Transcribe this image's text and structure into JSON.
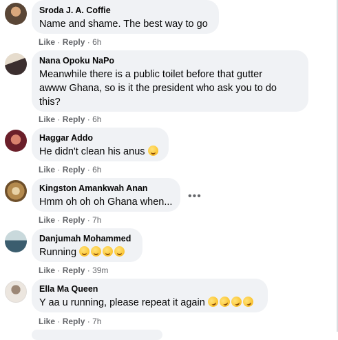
{
  "comments": [
    {
      "author": "Sroda J. A. Coffie",
      "text": "Name and shame. The best way to go",
      "like": "Like",
      "reply": "Reply",
      "time": "6h",
      "avatar_colors": [
        "#6d5b4a",
        "#c8a27a"
      ]
    },
    {
      "author": "Nana Opoku NaPo",
      "text_line1": "Meanwhile there is a public toilet before that gutter",
      "text_line2": "awww Ghana, so is it the president who ask you to do",
      "text_line3": "this?",
      "like": "Like",
      "reply": "Reply",
      "time": "6h",
      "avatar_colors": [
        "#3a3030",
        "#d9c9b8"
      ]
    },
    {
      "author": "Haggar Addo",
      "text": "He didn't clean his anus",
      "emoji": "grinning-face",
      "like": "Like",
      "reply": "Reply",
      "time": "6h",
      "avatar_colors": [
        "#6b1f2a",
        "#d07a6a"
      ]
    },
    {
      "author": "Kingston Amankwah Anan",
      "text": "Hmm oh oh oh Ghana when...",
      "like": "Like",
      "reply": "Reply",
      "time": "7h",
      "avatar_colors": [
        "#8a6a3a",
        "#e8d2a6"
      ]
    },
    {
      "author": "Danjumah Mohammed",
      "text": "Running",
      "emojis": [
        "grinning-squinting-face",
        "grinning-squinting-face",
        "grinning-squinting-face",
        "grinning-squinting-face"
      ],
      "like": "Like",
      "reply": "Reply",
      "time": "39m",
      "avatar_colors": [
        "#3b5d6e",
        "#9fb7b0"
      ]
    },
    {
      "author": "Ella Ma Queen",
      "text": "Y aa u running, please repeat it again",
      "emojis": [
        "rolling-on-floor-laughing",
        "rolling-on-floor-laughing",
        "rolling-on-floor-laughing",
        "rolling-on-floor-laughing"
      ],
      "like": "Like",
      "reply": "Reply",
      "time": "7h",
      "avatar_colors": [
        "#e9e2da",
        "#8c7b6a"
      ]
    }
  ],
  "separator": "·",
  "more_options_icon": "ellipsis-icon",
  "colors": {
    "bubble": "#f0f2f5",
    "meta": "#65676b",
    "text": "#050505"
  }
}
